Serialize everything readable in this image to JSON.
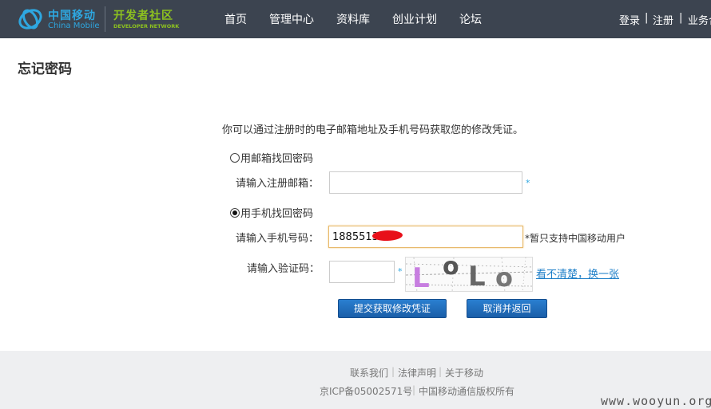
{
  "header": {
    "brand_cn": "中国移动",
    "brand_en": "China Mobile",
    "dev_cn": "开发者社区",
    "dev_en": "DEVELOPER NETWORK",
    "nav": [
      "首页",
      "管理中心",
      "资料库",
      "创业计划",
      "论坛"
    ],
    "login": "登录",
    "register": "注册",
    "business": "业务合"
  },
  "page": {
    "title": "忘记密码"
  },
  "form": {
    "intro": "你可以通过注册时的电子邮箱地址及手机号码获取您的修改凭证。",
    "email_option": "用邮箱找回密码",
    "email_label": "请输入注册邮箱：",
    "email_value": "",
    "phone_option": "用手机找回密码",
    "phone_label": "请输入手机号码：",
    "phone_value": "1885513",
    "phone_hint": "*暂只支持中国移动用户",
    "captcha_label": "请输入验证码：",
    "captcha_value": "",
    "refresh_link": "看不清楚，换一张",
    "required_mark": "*",
    "submit_label": "提交获取修改凭证",
    "cancel_label": "取消并返回"
  },
  "captcha": {
    "chars": [
      "L",
      "o",
      "L",
      "o"
    ]
  },
  "footer": {
    "links": [
      "联系我们",
      "法律声明",
      "关于移动"
    ],
    "icp": "京ICP备05002571号",
    "copyright": "中国移动通信版权所有"
  },
  "watermark": "www.wooyun.org",
  "colors": {
    "header_bg": "#3c4450",
    "brand_blue": "#2ea7e0",
    "dev_green": "#8dc21f",
    "button_blue": "#1a5ea8"
  }
}
